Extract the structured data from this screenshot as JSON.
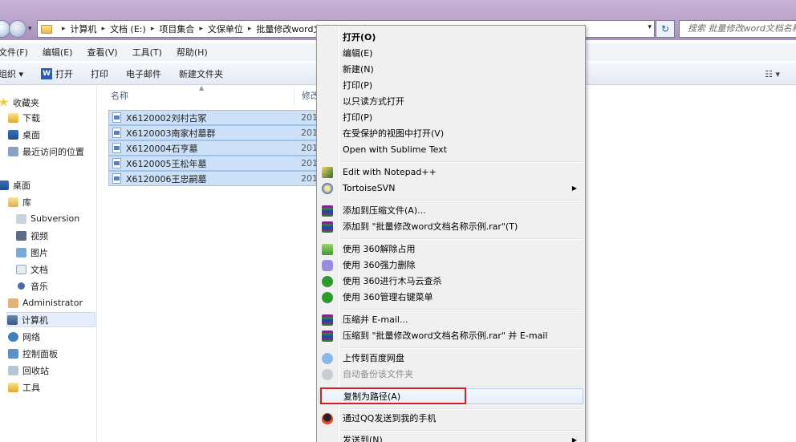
{
  "address": {
    "crumbs": [
      "计算机",
      "文档 (E:)",
      "项目集合",
      "文保单位",
      "批量修改word文档名称示例"
    ],
    "search_placeholder": "搜索 批量修改word文档名称示例"
  },
  "menubar": [
    "文件(F)",
    "编辑(E)",
    "查看(V)",
    "工具(T)",
    "帮助(H)"
  ],
  "toolbar": {
    "organize": "组织 ▾",
    "open": "打开",
    "print": "打印",
    "email": "电子邮件",
    "newfolder": "新建文件夹"
  },
  "sidebar": {
    "favorites": "收藏夹",
    "downloads": "下载",
    "desktop_fav": "桌面",
    "recent": "最近访问的位置",
    "desktop": "桌面",
    "libraries": "库",
    "subversion": "Subversion",
    "videos": "视频",
    "pictures": "图片",
    "documents": "文档",
    "music": "音乐",
    "administrator": "Administrator",
    "computer": "计算机",
    "network": "网络",
    "control_panel": "控制面板",
    "recycle_bin": "回收站",
    "tools": "工具"
  },
  "filelist": {
    "col_name": "名称",
    "col_modified": "修改",
    "rows": [
      {
        "name": "X6120002刘村古冢",
        "date": "201"
      },
      {
        "name": "X6120003南家村墓群",
        "date": "201"
      },
      {
        "name": "X6120004石亨墓",
        "date": "201"
      },
      {
        "name": "X6120005王松年墓",
        "date": "201"
      },
      {
        "name": "X6120006王忠嗣墓",
        "date": "201"
      }
    ]
  },
  "context_menu": {
    "open": "打开(O)",
    "edit": "编辑(E)",
    "new": "新建(N)",
    "print1": "打印(P)",
    "readonly": "以只读方式打开",
    "print2": "打印(P)",
    "protected": "在受保护的视图中打开(V)",
    "sublime": "Open with Sublime Text",
    "notepad": "Edit with Notepad++",
    "svn": "TortoiseSVN",
    "rar_add": "添加到压缩文件(A)...",
    "rar_add_named": "添加到 \"批量修改word文档名称示例.rar\"(T)",
    "q360_unlock": "使用 360解除占用",
    "q360_delete": "使用 360强力删除",
    "q360_scan": "使用 360进行木马云查杀",
    "q360_manage": "使用 360管理右键菜单",
    "zip_email": "压缩并 E-mail...",
    "zip_named_email": "压缩到 \"批量修改word文档名称示例.rar\" 并 E-mail",
    "baidu_upload": "上传到百度网盘",
    "baidu_backup": "自动备份该文件夹",
    "copy_path": "复制为路径(A)",
    "qq_send": "通过QQ发送到我的手机",
    "send_to": "发送到(N)"
  }
}
